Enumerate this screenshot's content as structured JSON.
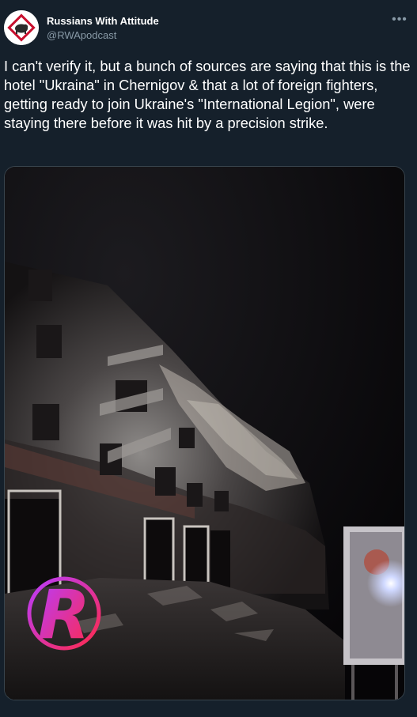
{
  "author": {
    "name": "Russians With Attitude",
    "handle": "@RWApodcast",
    "avatar_icon": "rwa-logo-avatar"
  },
  "tweet": {
    "text": "I can't verify it, but a bunch of sources are saying that this is the hotel \"Ukraina\" in Chernigov & that a lot of foreign fighters, getting ready to join Ukraine's \"International Legion\", were staying there before it was hit by a precision strike."
  },
  "media": {
    "watermark_letter": "R",
    "content": "night photo of a damaged multi-storey building"
  },
  "icons": {
    "more": "more-options-icon"
  },
  "colors": {
    "background": "#15202b",
    "primary_text": "#ffffff",
    "secondary_text": "#8899a6",
    "border": "#38444d"
  }
}
